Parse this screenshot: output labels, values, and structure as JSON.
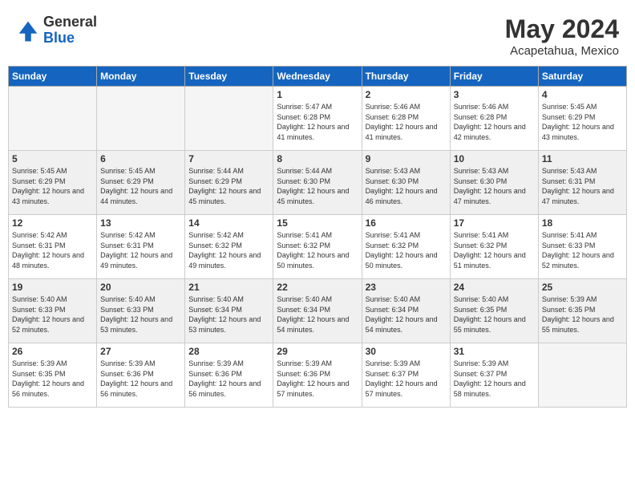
{
  "logo": {
    "general": "General",
    "blue": "Blue"
  },
  "title": "May 2024",
  "location": "Acapetahua, Mexico",
  "days_of_week": [
    "Sunday",
    "Monday",
    "Tuesday",
    "Wednesday",
    "Thursday",
    "Friday",
    "Saturday"
  ],
  "weeks": [
    [
      {
        "day": "",
        "empty": true
      },
      {
        "day": "",
        "empty": true
      },
      {
        "day": "",
        "empty": true
      },
      {
        "day": "1",
        "sunrise": "5:47 AM",
        "sunset": "6:28 PM",
        "daylight": "12 hours and 41 minutes."
      },
      {
        "day": "2",
        "sunrise": "5:46 AM",
        "sunset": "6:28 PM",
        "daylight": "12 hours and 41 minutes."
      },
      {
        "day": "3",
        "sunrise": "5:46 AM",
        "sunset": "6:28 PM",
        "daylight": "12 hours and 42 minutes."
      },
      {
        "day": "4",
        "sunrise": "5:45 AM",
        "sunset": "6:29 PM",
        "daylight": "12 hours and 43 minutes."
      }
    ],
    [
      {
        "day": "5",
        "sunrise": "5:45 AM",
        "sunset": "6:29 PM",
        "daylight": "12 hours and 43 minutes."
      },
      {
        "day": "6",
        "sunrise": "5:45 AM",
        "sunset": "6:29 PM",
        "daylight": "12 hours and 44 minutes."
      },
      {
        "day": "7",
        "sunrise": "5:44 AM",
        "sunset": "6:29 PM",
        "daylight": "12 hours and 45 minutes."
      },
      {
        "day": "8",
        "sunrise": "5:44 AM",
        "sunset": "6:30 PM",
        "daylight": "12 hours and 45 minutes."
      },
      {
        "day": "9",
        "sunrise": "5:43 AM",
        "sunset": "6:30 PM",
        "daylight": "12 hours and 46 minutes."
      },
      {
        "day": "10",
        "sunrise": "5:43 AM",
        "sunset": "6:30 PM",
        "daylight": "12 hours and 47 minutes."
      },
      {
        "day": "11",
        "sunrise": "5:43 AM",
        "sunset": "6:31 PM",
        "daylight": "12 hours and 47 minutes."
      }
    ],
    [
      {
        "day": "12",
        "sunrise": "5:42 AM",
        "sunset": "6:31 PM",
        "daylight": "12 hours and 48 minutes."
      },
      {
        "day": "13",
        "sunrise": "5:42 AM",
        "sunset": "6:31 PM",
        "daylight": "12 hours and 49 minutes."
      },
      {
        "day": "14",
        "sunrise": "5:42 AM",
        "sunset": "6:32 PM",
        "daylight": "12 hours and 49 minutes."
      },
      {
        "day": "15",
        "sunrise": "5:41 AM",
        "sunset": "6:32 PM",
        "daylight": "12 hours and 50 minutes."
      },
      {
        "day": "16",
        "sunrise": "5:41 AM",
        "sunset": "6:32 PM",
        "daylight": "12 hours and 50 minutes."
      },
      {
        "day": "17",
        "sunrise": "5:41 AM",
        "sunset": "6:32 PM",
        "daylight": "12 hours and 51 minutes."
      },
      {
        "day": "18",
        "sunrise": "5:41 AM",
        "sunset": "6:33 PM",
        "daylight": "12 hours and 52 minutes."
      }
    ],
    [
      {
        "day": "19",
        "sunrise": "5:40 AM",
        "sunset": "6:33 PM",
        "daylight": "12 hours and 52 minutes."
      },
      {
        "day": "20",
        "sunrise": "5:40 AM",
        "sunset": "6:33 PM",
        "daylight": "12 hours and 53 minutes."
      },
      {
        "day": "21",
        "sunrise": "5:40 AM",
        "sunset": "6:34 PM",
        "daylight": "12 hours and 53 minutes."
      },
      {
        "day": "22",
        "sunrise": "5:40 AM",
        "sunset": "6:34 PM",
        "daylight": "12 hours and 54 minutes."
      },
      {
        "day": "23",
        "sunrise": "5:40 AM",
        "sunset": "6:34 PM",
        "daylight": "12 hours and 54 minutes."
      },
      {
        "day": "24",
        "sunrise": "5:40 AM",
        "sunset": "6:35 PM",
        "daylight": "12 hours and 55 minutes."
      },
      {
        "day": "25",
        "sunrise": "5:39 AM",
        "sunset": "6:35 PM",
        "daylight": "12 hours and 55 minutes."
      }
    ],
    [
      {
        "day": "26",
        "sunrise": "5:39 AM",
        "sunset": "6:35 PM",
        "daylight": "12 hours and 56 minutes."
      },
      {
        "day": "27",
        "sunrise": "5:39 AM",
        "sunset": "6:36 PM",
        "daylight": "12 hours and 56 minutes."
      },
      {
        "day": "28",
        "sunrise": "5:39 AM",
        "sunset": "6:36 PM",
        "daylight": "12 hours and 56 minutes."
      },
      {
        "day": "29",
        "sunrise": "5:39 AM",
        "sunset": "6:36 PM",
        "daylight": "12 hours and 57 minutes."
      },
      {
        "day": "30",
        "sunrise": "5:39 AM",
        "sunset": "6:37 PM",
        "daylight": "12 hours and 57 minutes."
      },
      {
        "day": "31",
        "sunrise": "5:39 AM",
        "sunset": "6:37 PM",
        "daylight": "12 hours and 58 minutes."
      },
      {
        "day": "",
        "empty": true
      }
    ]
  ]
}
